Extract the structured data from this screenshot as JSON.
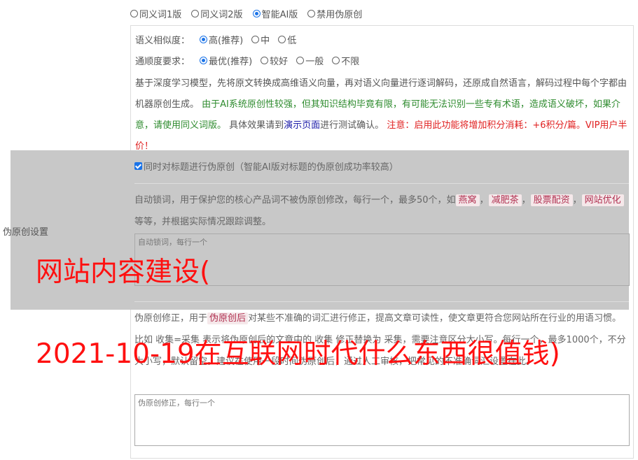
{
  "mode_options": [
    {
      "label": "同义词1版",
      "checked": false
    },
    {
      "label": "同义词2版",
      "checked": false
    },
    {
      "label": "智能AI版",
      "checked": true
    },
    {
      "label": "禁用伪原创",
      "checked": false
    }
  ],
  "similarity": {
    "label": "语义相似度：",
    "options": [
      {
        "label": "高(推荐)",
        "checked": true
      },
      {
        "label": "中",
        "checked": false
      },
      {
        "label": "低",
        "checked": false
      }
    ]
  },
  "fluency": {
    "label": "通顺度要求：",
    "options": [
      {
        "label": "最优(推荐)",
        "checked": true
      },
      {
        "label": "较好",
        "checked": false
      },
      {
        "label": "一般",
        "checked": false
      },
      {
        "label": "不限",
        "checked": false
      }
    ]
  },
  "description": {
    "part1": "基于深度学习模型，先将原文转换成高维语义向量，再对语义向量进行逐词解码，还原成自然语言，解码过程中每个字都由机器原创生成。 ",
    "part2": "由于AI系统原创性较强，但其知识结构毕竟有限，有可能无法识别一些专有术语，造成语义破坏，如果介意，请使用同义词版。",
    "part3": " 具体效果请到",
    "link": "演示页面",
    "part4": "进行测试确认。 ",
    "part5": "注意：启用此功能将增加积分消耗：+6积分/篇。VIP用户半价！"
  },
  "side_label": "伪原创设置",
  "title_checkbox": {
    "label": "同时对标题进行伪原创（智能AI版对标题的伪原创成功率较高）",
    "checked": true
  },
  "lock_words": {
    "text_before": "自动锁词，用于保护您的核心产品词不被伪原创修改，每行一个，最多50个，如",
    "tags": [
      "燕窝",
      "减肥茶",
      "股票配资",
      "网站优化"
    ],
    "text_after": "等等，并根据实际情况跟踪调整。",
    "placeholder": "自动锁词，每行一个"
  },
  "correction": {
    "text_before": "伪原创修正，用于",
    "tag": "伪原创后",
    "text_after": "对某些不准确的词汇进行修正，提高文章可读性，使文章更符合您网站所在行业的用语习惯。比如 收集=采集 表示将伪原创后的文章中的 收集 修正替换为 采集，需要注意区分大小写。每行一个，最多1000个，不分大小写，默认留空。建议在使用一段时间伪原创后，通过人工审核，把常见的不准确词汇设置在此。",
    "placeholder": "伪原创修正，每行一个"
  },
  "watermark": {
    "line1": "网站内容建设(",
    "line2": "2021-10-19在互联网时代什么东西很值钱)"
  }
}
